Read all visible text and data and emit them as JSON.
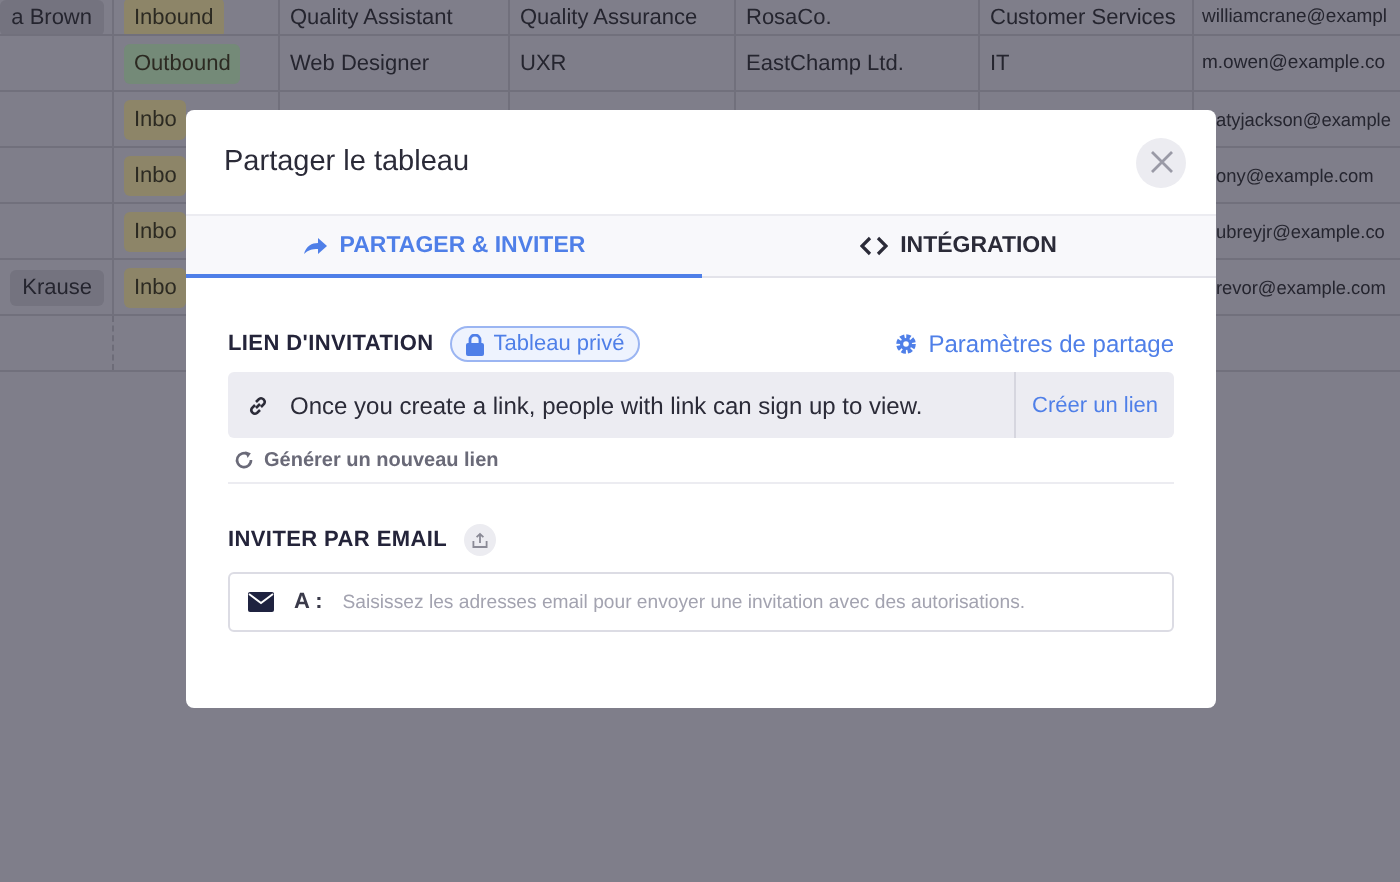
{
  "table": {
    "rows": [
      {
        "name": "a Brown",
        "direction": {
          "label": "Inbound",
          "color": "#8d8568"
        },
        "title": "Quality Assistant",
        "department": "Quality Assurance",
        "company": "RosaCo.",
        "team": "Customer Services",
        "email": "williamcrane@exampl"
      },
      {
        "direction": {
          "label": "Outbound",
          "color": "#748a78"
        },
        "title": "Web Designer",
        "department": "UXR",
        "company": "EastChamp Ltd.",
        "team": "IT",
        "email": "m.owen@example.co"
      },
      {
        "direction": {
          "label": "Inbo",
          "color": "#8d8568"
        },
        "email": "atyjackson@example"
      },
      {
        "direction": {
          "label": "Inbo",
          "color": "#8d8568"
        },
        "email": "ony@example.com"
      },
      {
        "direction": {
          "label": "Inbo",
          "color": "#8d8568"
        },
        "email": "ubreyjr@example.co"
      },
      {
        "name": "Krause",
        "direction": {
          "label": "Inbo",
          "color": "#8d8568"
        },
        "email": "revor@example.com"
      },
      {}
    ]
  },
  "dialog": {
    "title": "Partager le tableau",
    "tabs": [
      {
        "label": "PARTAGER & INVITER",
        "selected": true
      },
      {
        "label": "INTÉGRATION",
        "selected": false
      }
    ],
    "invite_link": {
      "heading": "LIEN D'INVITATION",
      "privacy_badge": "Tableau privé",
      "settings_link": "Paramètres de partage",
      "message": "Once you create a link, people with link can sign up to view.",
      "create_button": "Créer un lien",
      "regenerate_link": "Générer un nouveau lien"
    },
    "invite_email": {
      "heading": "INVITER PAR EMAIL",
      "to_label": "A :",
      "placeholder": "Saisissez les adresses email pour envoyer une invitation avec des autorisations."
    }
  }
}
